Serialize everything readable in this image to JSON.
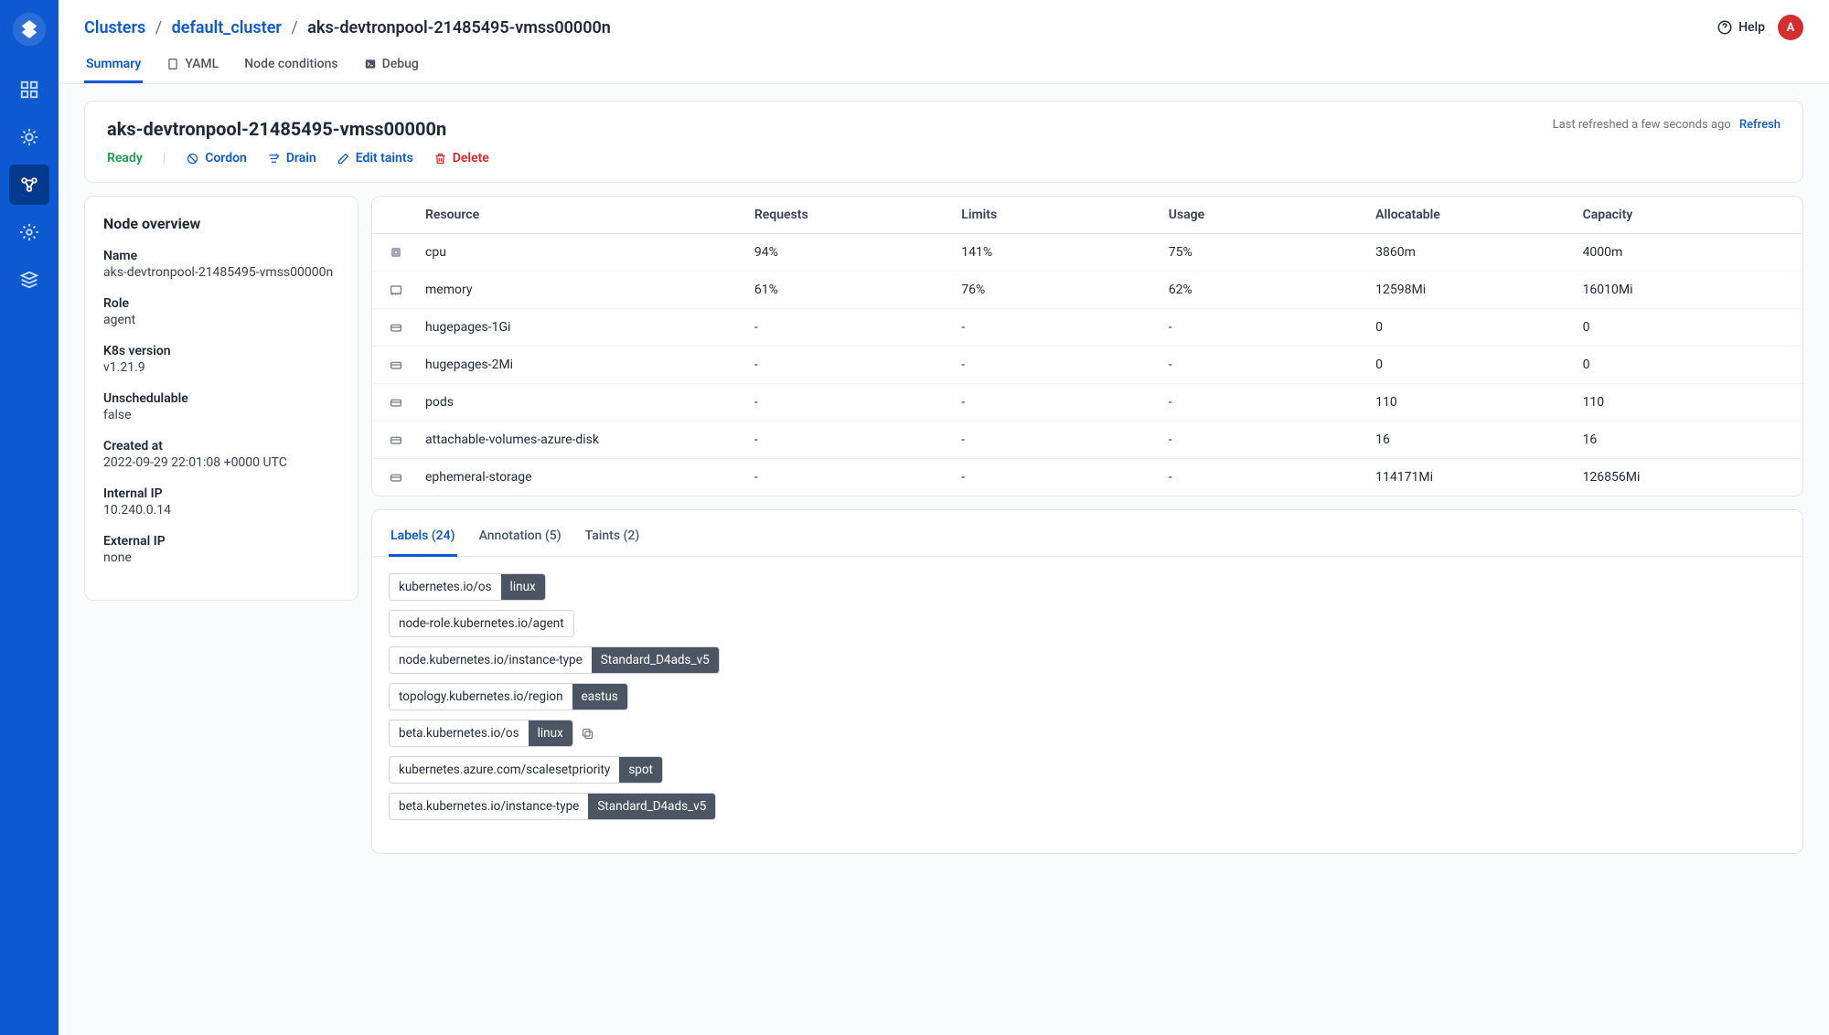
{
  "breadcrumbs": {
    "root": "Clusters",
    "cluster": "default_cluster",
    "node": "aks-devtronpool-21485495-vmss00000n"
  },
  "top_right": {
    "help": "Help",
    "avatar_initial": "A"
  },
  "subtabs": {
    "summary": "Summary",
    "yaml": "YAML",
    "node_conditions": "Node conditions",
    "debug": "Debug"
  },
  "header": {
    "title": "aks-devtronpool-21485495-vmss00000n",
    "last_refreshed": "Last refreshed a few seconds ago",
    "refresh": "Refresh",
    "status": "Ready",
    "actions": {
      "cordon": "Cordon",
      "drain": "Drain",
      "edit_taints": "Edit taints",
      "delete": "Delete"
    }
  },
  "overview": {
    "heading": "Node overview",
    "name_label": "Name",
    "name_value": "aks-devtronpool-21485495-vmss00000n",
    "role_label": "Role",
    "role_value": "agent",
    "k8s_label": "K8s version",
    "k8s_value": "v1.21.9",
    "unsched_label": "Unschedulable",
    "unsched_value": "false",
    "created_label": "Created at",
    "created_value": "2022-09-29 22:01:08 +0000 UTC",
    "internal_ip_label": "Internal IP",
    "internal_ip_value": "10.240.0.14",
    "external_ip_label": "External IP",
    "external_ip_value": "none"
  },
  "resources": {
    "headers": {
      "resource": "Resource",
      "requests": "Requests",
      "limits": "Limits",
      "usage": "Usage",
      "allocatable": "Allocatable",
      "capacity": "Capacity"
    },
    "rows": [
      {
        "name": "cpu",
        "requests": "94%",
        "limits": "141%",
        "usage": "75%",
        "allocatable": "3860m",
        "capacity": "4000m"
      },
      {
        "name": "memory",
        "requests": "61%",
        "limits": "76%",
        "usage": "62%",
        "allocatable": "12598Mi",
        "capacity": "16010Mi"
      },
      {
        "name": "hugepages-1Gi",
        "requests": "-",
        "limits": "-",
        "usage": "-",
        "allocatable": "0",
        "capacity": "0"
      },
      {
        "name": "hugepages-2Mi",
        "requests": "-",
        "limits": "-",
        "usage": "-",
        "allocatable": "0",
        "capacity": "0"
      },
      {
        "name": "pods",
        "requests": "-",
        "limits": "-",
        "usage": "-",
        "allocatable": "110",
        "capacity": "110"
      },
      {
        "name": "attachable-volumes-azure-disk",
        "requests": "-",
        "limits": "-",
        "usage": "-",
        "allocatable": "16",
        "capacity": "16"
      },
      {
        "name": "ephemeral-storage",
        "requests": "-",
        "limits": "-",
        "usage": "-",
        "allocatable": "114171Mi",
        "capacity": "126856Mi"
      }
    ]
  },
  "label_tabs": {
    "labels": "Labels (24)",
    "annotations": "Annotation (5)",
    "taints": "Taints (2)"
  },
  "labels": [
    {
      "key": "kubernetes.io/os",
      "value": "linux"
    },
    {
      "key": "node-role.kubernetes.io/agent",
      "value": null
    },
    {
      "key": "node.kubernetes.io/instance-type",
      "value": "Standard_D4ads_v5"
    },
    {
      "key": "topology.kubernetes.io/region",
      "value": "eastus"
    },
    {
      "key": "beta.kubernetes.io/os",
      "value": "linux",
      "copy": true
    },
    {
      "key": "kubernetes.azure.com/scalesetpriority",
      "value": "spot"
    },
    {
      "key": "beta.kubernetes.io/instance-type",
      "value": "Standard_D4ads_v5"
    }
  ]
}
